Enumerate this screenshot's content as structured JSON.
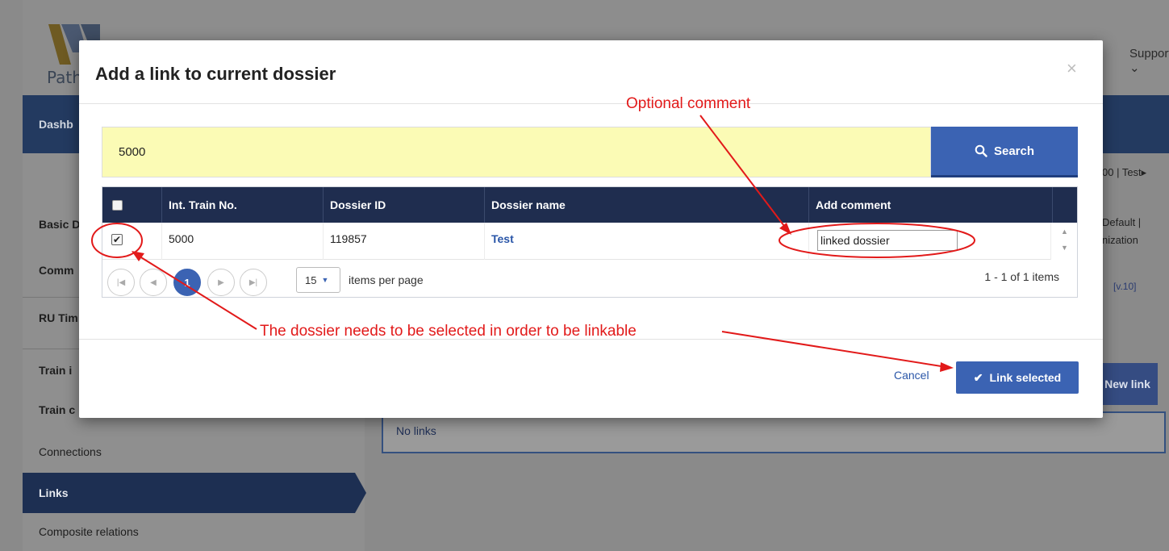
{
  "background": {
    "logo_text": "Path l",
    "support_label": "Support",
    "navbar_item": "Dashb",
    "sidebar_items": [
      "Basic D",
      "Comm",
      "RU Tim",
      "Train i",
      "Train c",
      "Connections",
      "Links",
      "Composite relations"
    ],
    "right_breadcrumb": "00 | Test▸",
    "right_box_line1": "Default |",
    "right_box_line2": "nization",
    "version": "[v.10]",
    "new_link_button": "New link",
    "no_links_text": "No links"
  },
  "modal": {
    "title": "Add a link to current dossier",
    "close_glyph": "×",
    "search": {
      "value": "5000",
      "button_label": "Search"
    },
    "table": {
      "columns": [
        "",
        "Int. Train No.",
        "Dossier ID",
        "Dossier name",
        "Add comment"
      ],
      "rows": [
        {
          "checked": true,
          "train_no": "5000",
          "dossier_id": "119857",
          "dossier_name": "Test",
          "comment": "linked dossier"
        }
      ]
    },
    "pager": {
      "current_page": "1",
      "page_size": "15",
      "items_per_page_label": "items per page",
      "info": "1 - 1 of 1 items"
    },
    "footer": {
      "cancel_label": "Cancel",
      "link_button_label": "Link selected"
    }
  },
  "annotations": {
    "optional_comment": "Optional comment",
    "select_note": "The dossier needs to be selected in order to be linkable",
    "color": "#e21a1a"
  },
  "colors": {
    "primary": "#3b63b3",
    "header_dark": "#1f2d4f",
    "search_bg": "#fbfbb5"
  }
}
